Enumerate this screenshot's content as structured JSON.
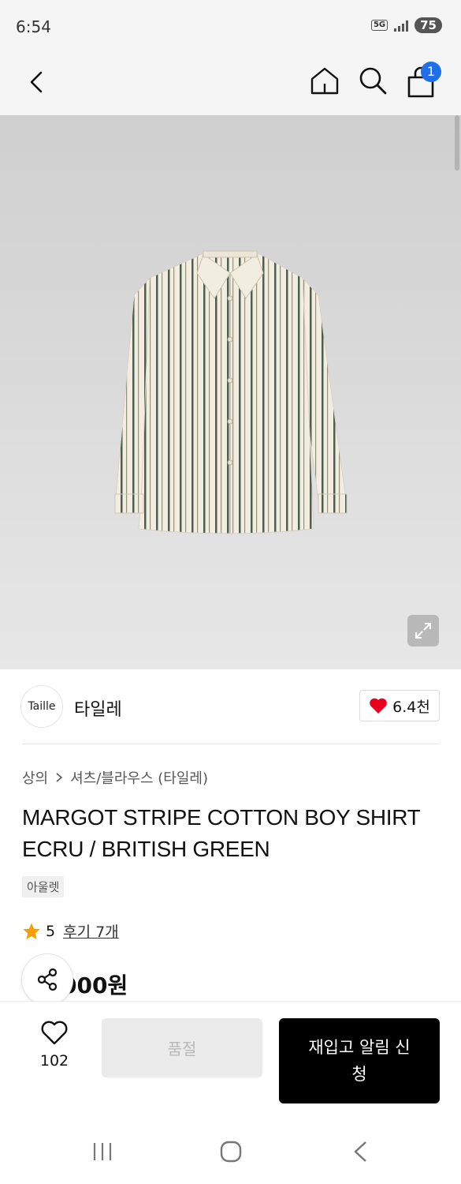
{
  "status_bar": {
    "time": "6:54",
    "network": "5G",
    "battery": "75"
  },
  "top_nav": {
    "cart_count": "1",
    "icons": [
      "back-icon",
      "home-icon",
      "search-icon",
      "cart-icon"
    ]
  },
  "brand": {
    "logo_text": "Taille",
    "name": "타일레",
    "likes": "6.4천"
  },
  "breadcrumb": {
    "category": "상의",
    "subcategory": "셔츠/블라우스 (타일레)"
  },
  "product": {
    "title": "MARGOT STRIPE COTTON BOY SHIRT ECRU / BRITISH GREEN",
    "badge": "아울렛",
    "rating": "5",
    "reviews": "후기 7개",
    "price": "000원"
  },
  "action_bar": {
    "wish_count": "102",
    "soldout_label": "품절",
    "restock_label": "재입고 알림 신청"
  },
  "colors": {
    "accent_blue": "#1f6fe8",
    "heart_red": "#e8001d",
    "star_orange": "#f5a000"
  }
}
